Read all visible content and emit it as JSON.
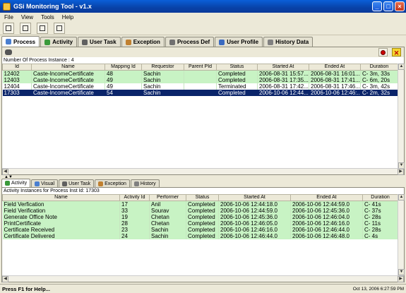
{
  "window": {
    "title": "GSi Monitoring Tool - v1.x"
  },
  "menu": [
    "File",
    "View",
    "Tools",
    "Help"
  ],
  "toolbar_icons": [
    "edit-icon",
    "tree-icon",
    "window-icon",
    "list-icon"
  ],
  "main_tabs": [
    {
      "label": "Process",
      "icon": "process-icon",
      "color": "#4a7fd0"
    },
    {
      "label": "Activity",
      "icon": "activity-icon",
      "color": "#3a9a3a"
    },
    {
      "label": "User Task",
      "icon": "user-task-icon",
      "color": "#606060"
    },
    {
      "label": "Exception",
      "icon": "exception-icon",
      "color": "#c08030"
    },
    {
      "label": "Process Def",
      "icon": "process-def-icon",
      "color": "#707070"
    },
    {
      "label": "User Profile",
      "icon": "user-profile-icon",
      "color": "#3a6ac0"
    },
    {
      "label": "History Data",
      "icon": "history-icon",
      "color": "#808080"
    }
  ],
  "process": {
    "count_label": "Number Of Process Instance : 4",
    "columns": [
      "Id",
      "Name",
      "Mapping Id",
      "Requestor",
      "Parent PId",
      "Status",
      "Started At",
      "Ended At",
      "Duration"
    ],
    "rows": [
      {
        "style": "green",
        "cells": [
          "12402",
          "Caste-IncomeCertificate",
          "48",
          "Sachin",
          "",
          "Completed",
          "2006-08-31 15:57...",
          "2006-08-31 16:01...",
          "C- 3m, 33s"
        ]
      },
      {
        "style": "green",
        "cells": [
          "12403",
          "Caste-IncomeCertificate",
          "49",
          "Sachin",
          "",
          "Completed",
          "2006-08-31 17:35...",
          "2006-08-31 17:41...",
          "C- 6m, 20s"
        ]
      },
      {
        "style": "white",
        "cells": [
          "12404",
          "Caste-IncomeCertificate",
          "49",
          "Sachin",
          "",
          "Terminated",
          "2006-08-31 17:42...",
          "2006-08-31 17:46...",
          "C- 3m, 42s"
        ]
      },
      {
        "style": "sel",
        "cells": [
          "17303",
          "Caste-IncomeCertificate",
          "54",
          "Sachin",
          "",
          "Completed",
          "2006-10-06 12:44...",
          "2006-10-06 12:46:...",
          "C- 2m, 32s"
        ]
      }
    ]
  },
  "sub_tabs": [
    {
      "label": "Activity",
      "icon": "activity-icon",
      "color": "#3a9a3a"
    },
    {
      "label": "Visual",
      "icon": "visual-icon",
      "color": "#4a7fd0"
    },
    {
      "label": "User Task",
      "icon": "user-task-icon",
      "color": "#606060"
    },
    {
      "label": "Exception",
      "icon": "exception-icon",
      "color": "#c08030"
    },
    {
      "label": "History",
      "icon": "history-icon",
      "color": "#808080"
    }
  ],
  "activity": {
    "header": "Activity Instances for Process Inst Id: 17303",
    "columns": [
      "Name",
      "Activity Id",
      "Performer",
      "Status",
      "Started At",
      "Ended At",
      "Duration"
    ],
    "rows": [
      [
        "Field Verfication",
        "17",
        "Anil",
        "Completed",
        "2006-10-06 12:44:18.0",
        "2006-10-06 12:44:59.0",
        "C- 41s"
      ],
      [
        "Field Verification",
        "33",
        "Sourav",
        "Completed",
        "2006-10-06 12:44:59.0",
        "2006-10-06 12:45:36.0",
        "C- 37s"
      ],
      [
        "Generate Office Note",
        "19",
        "Chetan",
        "Completed",
        "2006-10-06 12:45:36.0",
        "2006-10-06 12:46:04.0",
        "C- 28s"
      ],
      [
        "PrintCertificate",
        "28",
        "Chetan",
        "Completed",
        "2006-10-06 12:46:05.0",
        "2006-10-06 12:46:16.0",
        "C- 11s"
      ],
      [
        "Certificate Received",
        "23",
        "Sachin",
        "Completed",
        "2006-10-06 12:46:16.0",
        "2006-10-06 12:46:44.0",
        "C- 28s"
      ],
      [
        "Certificate Delivered",
        "24",
        "Sachin",
        "Completed",
        "2006-10-06 12:46:44.0",
        "2006-10-06 12:46:48.0",
        "C- 4s"
      ]
    ]
  },
  "status": {
    "left": "Press F1 for Help...",
    "right": "Oct 13, 2006 6:27:59 PM"
  }
}
